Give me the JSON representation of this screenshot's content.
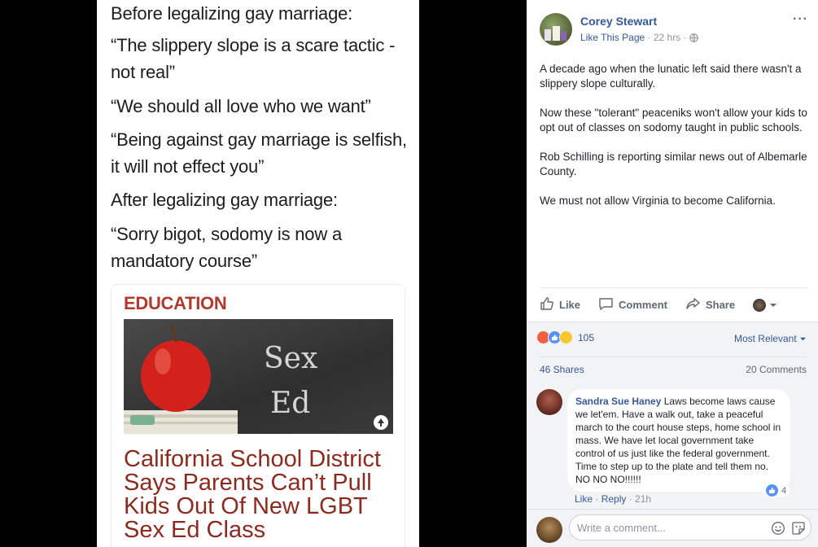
{
  "meme": {
    "line1": "Before legalizing gay marriage:",
    "quote1a": "“The slippery slope is a scare tactic -",
    "quote1b": "not real”",
    "quote2": "“We should all love who we want”",
    "quote3a": "“Being against gay marriage is selfish,",
    "quote3b": "it will not effect you”",
    "line2": "After legalizing gay marriage:",
    "quote4a": "“Sorry bigot, sodomy is now a",
    "quote4b": "mandatory course”",
    "article": {
      "category": "EDUCATION",
      "chalk_line1": "Sex",
      "chalk_line2": "Ed",
      "headline": "California School District Says Parents Can’t Pull Kids Out Of New LGBT Sex Ed Class"
    }
  },
  "post": {
    "author": "Corey Stewart",
    "like_page": "Like This Page",
    "meta_sep": " · ",
    "time": "22 hrs",
    "privacy_icon": "globe-icon",
    "body": [
      "A decade ago when the lunatic left said there wasn't a slippery slope culturally.",
      "Now these \"tolerant\" peaceniks won't allow your kids to opt out of classes on sodomy taught in public schools.",
      "Rob Schilling is reporting similar news out of Albemarle County.",
      "We must not allow Virginia to become California."
    ],
    "actions": {
      "like": "Like",
      "comment": "Comment",
      "share": "Share"
    },
    "reactions_count": "105",
    "sort_label": "Most Relevant",
    "shares": "46 Shares",
    "comments": "20 Comments"
  },
  "comment": {
    "name": "Sandra Sue Haney",
    "text": "Laws become laws cause we let'em. Have a walk out, take a peaceful march to the court house steps, home school in mass. We have let local government take control of us just like the federal government. Time to step up to the plate and tell them no. NO NO NO!!!!!!",
    "likes": "4",
    "like_action": "Like",
    "reply_action": "Reply",
    "sep": " · ",
    "time": "21h"
  },
  "composer": {
    "placeholder": "Write a comment..."
  },
  "colors": {
    "fb_link": "#365899",
    "headline": "#8b2b1f",
    "category": "#b03a2e"
  }
}
